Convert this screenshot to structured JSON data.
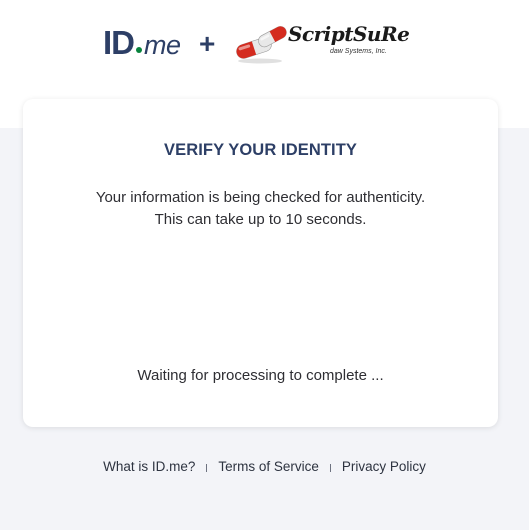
{
  "header": {
    "idme_logo": {
      "id_text": "ID",
      "me_text": "me",
      "dot_color": "#08833d"
    },
    "plus_text": "+",
    "partner_logo": {
      "name_text": "ScriptSuRe",
      "sub_text": "daw Systems, Inc.",
      "capsule_red": "#d42b1f",
      "capsule_white": "#e8e8e8"
    }
  },
  "card": {
    "title": "VERIFY YOUR IDENTITY",
    "message_line_1": "Your information is being checked for authenticity.",
    "message_line_2": "This can take up to 10 seconds.",
    "waiting_text": "Waiting for processing to complete ..."
  },
  "footer": {
    "links": [
      {
        "label": "What is ID.me?"
      },
      {
        "label": "Terms of Service"
      },
      {
        "label": "Privacy Policy"
      }
    ]
  },
  "colors": {
    "brand_navy": "#2d3f66",
    "page_bg": "#f3f4f8",
    "card_bg": "#ffffff",
    "text": "#2e2e33"
  }
}
